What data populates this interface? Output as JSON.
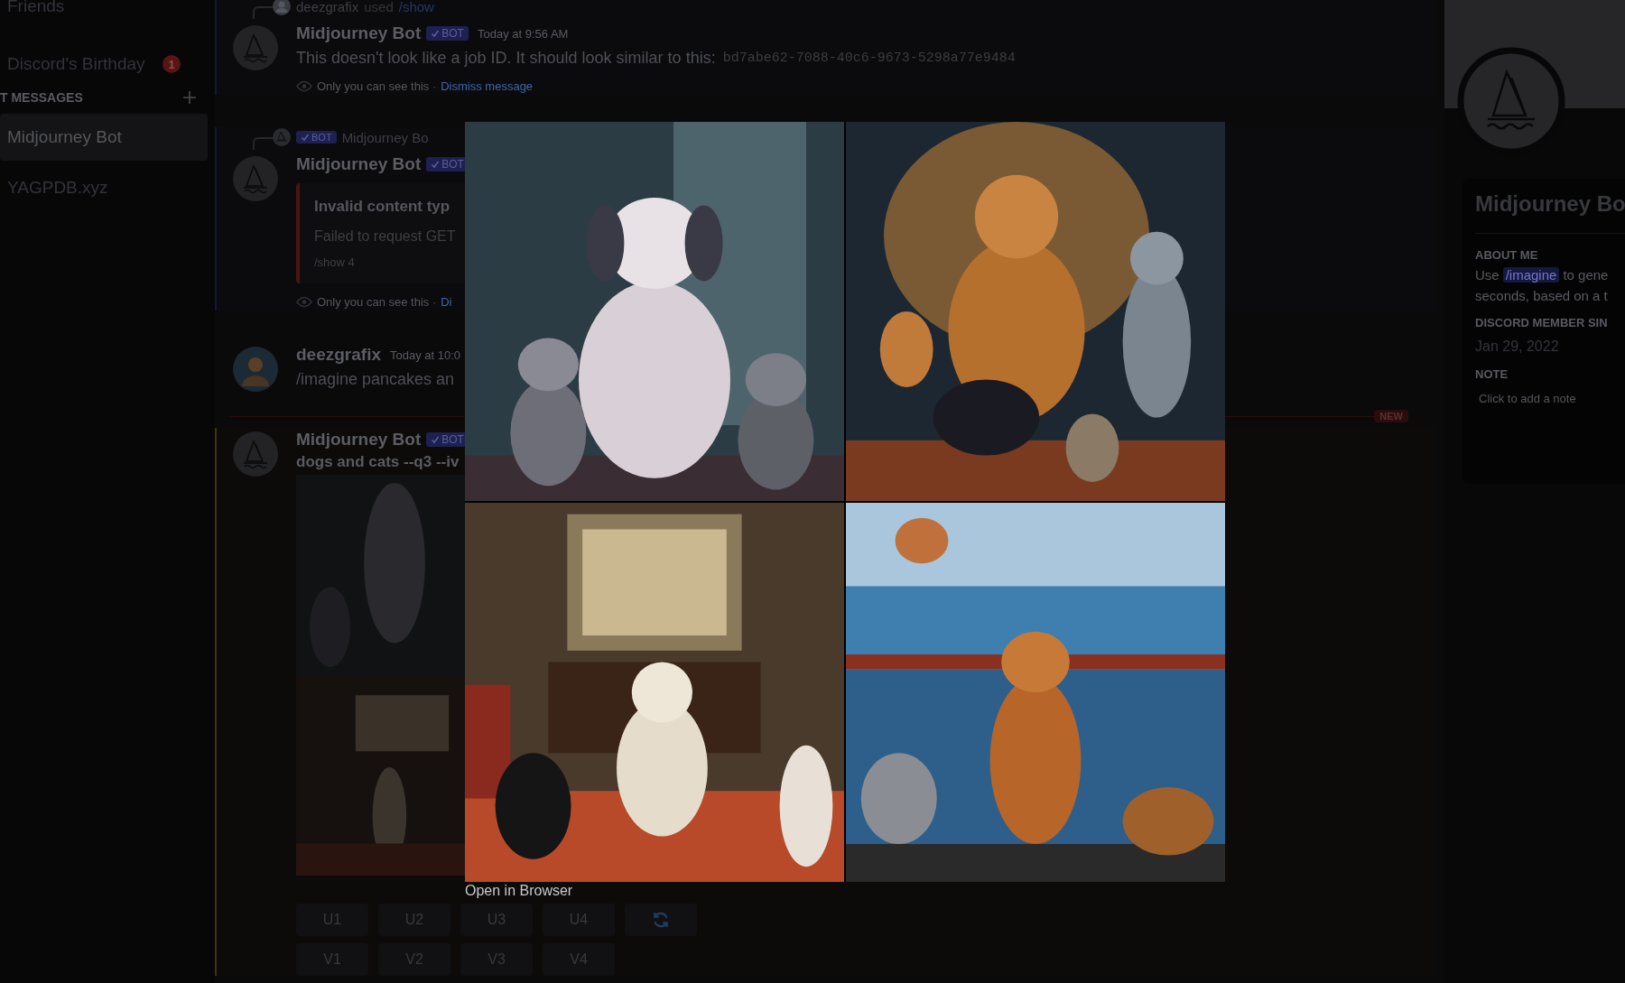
{
  "sidebar": {
    "items": [
      {
        "label": "Friends",
        "selected": false
      },
      {
        "label": "Discord's Birthday",
        "badge": "1",
        "selected": false
      }
    ],
    "section_header": "T MESSAGES",
    "dms": [
      {
        "label": "Midjourney Bot",
        "selected": true
      },
      {
        "label": "YAGPDB.xyz",
        "selected": false
      }
    ]
  },
  "messages": [
    {
      "kind": "message",
      "author": "Midjourney Bot",
      "avatar": {
        "kind": "bot"
      },
      "bot_tag": "BOT",
      "time": "Today at 9:56 AM",
      "ephemeral": true,
      "mention": false,
      "reply": {
        "kind": "command",
        "user": "deezgrafix",
        "text": "used",
        "command": "/show"
      },
      "text": "This doesn't look like a job ID. It should look similar to this:",
      "code": "bd7abe62-7088-40c6-9673-5298a77e9484",
      "notice": "Only you can see this ·",
      "notice_link": "Dismiss message"
    },
    {
      "kind": "message",
      "author": "Midjourney Bot",
      "avatar": {
        "kind": "bot"
      },
      "bot_tag": "BOT",
      "ephemeral": true,
      "mention": false,
      "reply": {
        "kind": "bot",
        "tag": "BOT",
        "user": "Midjourney Bo"
      },
      "embed": {
        "title": "Invalid content typ",
        "description": "Failed to request GET",
        "footer": "/show 4"
      },
      "notice": "Only you can see this ·",
      "notice_link": "Di"
    },
    {
      "kind": "message",
      "author": "deezgrafix",
      "avatar": {
        "kind": "user"
      },
      "time": "Today at 10:0",
      "ephemeral": false,
      "mention": false,
      "text": "/imagine pancakes an"
    },
    {
      "kind": "divider",
      "label": "NEW"
    },
    {
      "kind": "message",
      "author": "Midjourney Bot",
      "avatar": {
        "kind": "bot"
      },
      "bot_tag": "BOT",
      "ephemeral": false,
      "mention": true,
      "prompt": "dogs and cats --q3 --iv",
      "attachment": {
        "kind": "picture"
      },
      "button_rows": [
        [
          {
            "kind": "text",
            "label": "U1"
          },
          {
            "kind": "text",
            "label": "U2"
          },
          {
            "kind": "text",
            "label": "U3"
          },
          {
            "kind": "text",
            "label": "U4"
          },
          {
            "kind": "refresh"
          }
        ],
        [
          {
            "kind": "text",
            "label": "V1"
          },
          {
            "kind": "text",
            "label": "V2"
          },
          {
            "kind": "text",
            "label": "V3"
          },
          {
            "kind": "text",
            "label": "V4"
          }
        ]
      ]
    }
  ],
  "profile": {
    "name": "Midjourney Bo",
    "sections": [
      {
        "kind": "about",
        "heading": "ABOUT ME",
        "prefix": "Use",
        "command": "/imagine",
        "suffix": "to gene",
        "line2": "seconds, based on a t"
      },
      {
        "kind": "member_since",
        "heading": "DISCORD MEMBER SIN",
        "value": "Jan 29, 2022"
      },
      {
        "kind": "note",
        "heading": "NOTE",
        "placeholder": "Click to add a note"
      }
    ]
  },
  "lightbox": {
    "panels": [
      {
        "kind": "picture"
      },
      {
        "kind": "picture"
      },
      {
        "kind": "picture"
      },
      {
        "kind": "picture"
      }
    ],
    "link": "Open in Browser"
  }
}
